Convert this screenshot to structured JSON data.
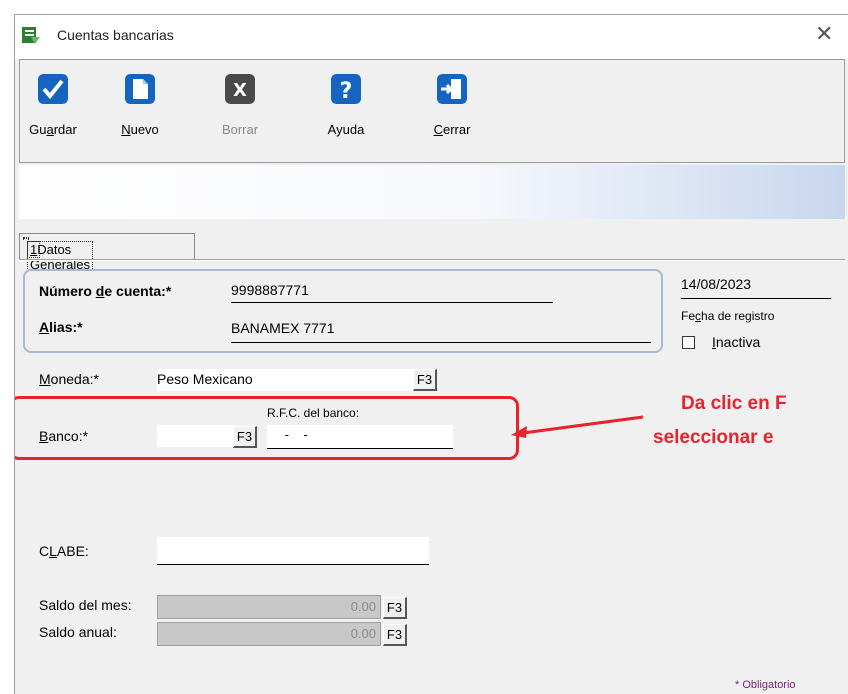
{
  "window": {
    "title": "Cuentas bancarias",
    "close_glyph": "✕"
  },
  "toolbar": {
    "buttons": [
      {
        "label_pre": "Gu",
        "label_key": "a",
        "label_post": "rdar",
        "icon": "checkmark-icon",
        "color": "#1565c0",
        "enabled": true
      },
      {
        "label_pre": "",
        "label_key": "N",
        "label_post": "uevo",
        "icon": "new-document-icon",
        "color": "#1565c0",
        "enabled": true
      },
      {
        "label_pre": "Borrar",
        "label_key": "",
        "label_post": "",
        "icon": "delete-x-icon",
        "color": "#555555",
        "enabled": false
      },
      {
        "label_pre": "Ayuda",
        "label_key": "",
        "label_post": "",
        "icon": "help-question-icon",
        "color": "#1565c0",
        "enabled": true
      },
      {
        "label_pre": "",
        "label_key": "C",
        "label_post": "errar",
        "icon": "exit-door-icon",
        "color": "#1565c0",
        "enabled": true
      }
    ]
  },
  "tab": {
    "key": "1",
    "rest": ". Datos Generales"
  },
  "form": {
    "numero_label_pre": "Número ",
    "numero_label_key": "d",
    "numero_label_post": "e cuenta:*",
    "numero_value": "9998887771",
    "alias_label_key": "A",
    "alias_label_post": "lias:*",
    "alias_value": "BANAMEX 7771",
    "fecha_value": "14/08/2023",
    "fecha_label_pre": "Fe",
    "fecha_label_key": "c",
    "fecha_label_post": "ha de registro",
    "inactiva_label_key": "I",
    "inactiva_label_post": "nactiva",
    "moneda_label_key": "M",
    "moneda_label_post": "oneda:*",
    "moneda_value": "Peso Mexicano",
    "banco_label_key": "B",
    "banco_label_post": "anco:*",
    "banco_value": "",
    "rfc_label": "R.F.C. del banco:",
    "rfc_value": " -    -",
    "clabe_label_pre": "C",
    "clabe_label_key": "L",
    "clabe_label_post": "ABE:",
    "clabe_value": "",
    "saldo_mes_label": "Saldo del mes:",
    "saldo_mes_value": "0.00",
    "saldo_anual_label": "Saldo anual:",
    "saldo_anual_value": "0.00",
    "f3_label": "F3",
    "obligatorio": "* Obligatorio"
  },
  "annotation": {
    "line1": "Da clic en F",
    "line2": "seleccionar e",
    "color": "#e8232d"
  }
}
